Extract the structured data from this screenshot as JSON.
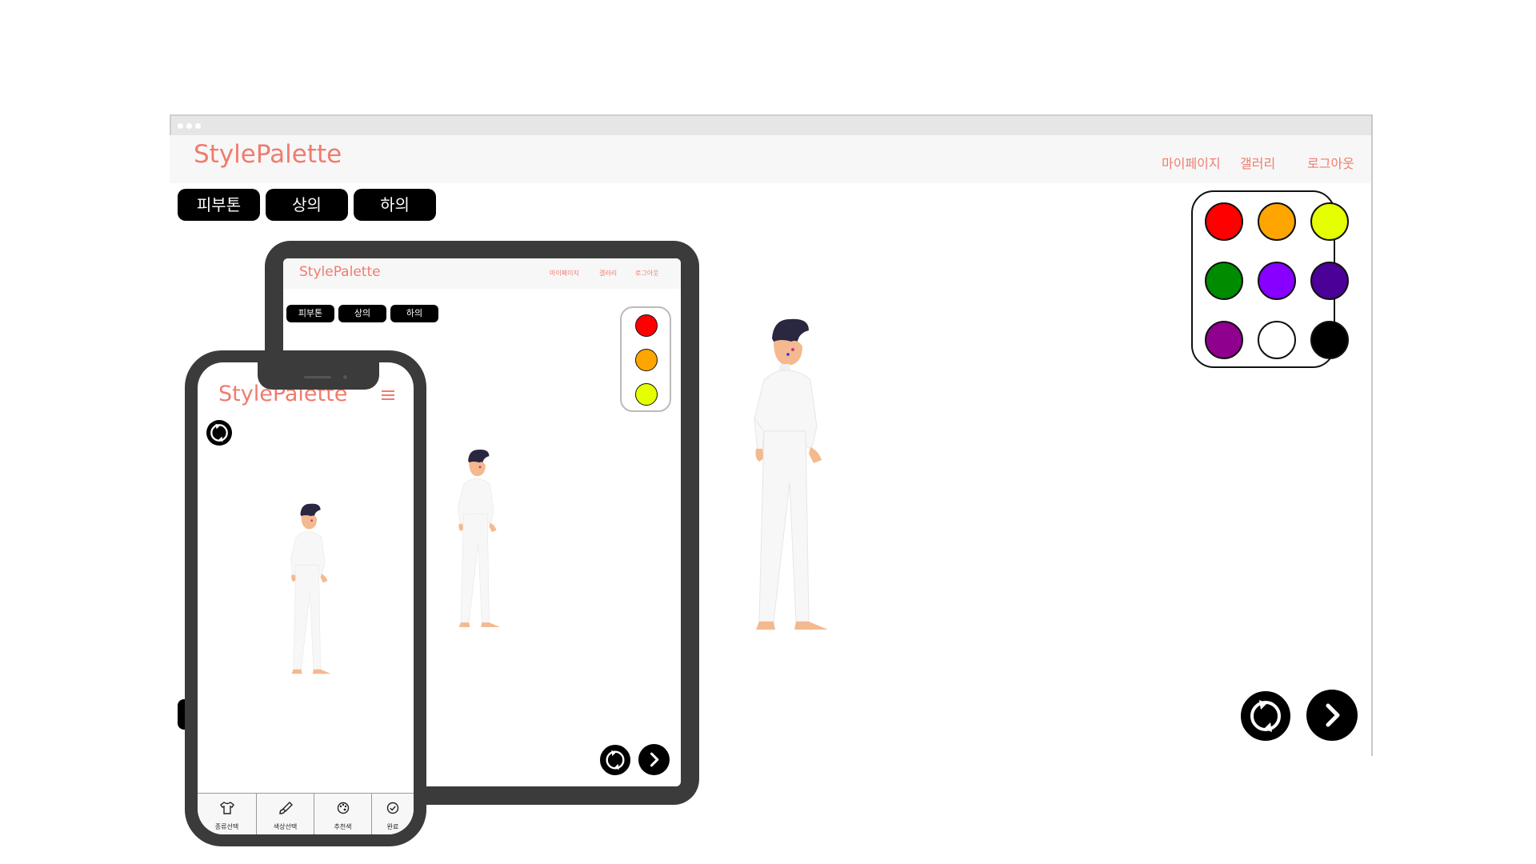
{
  "desktop": {
    "brand": "StylePalette",
    "nav": [
      "마이페이지",
      "갤러리",
      "로그아웃"
    ],
    "categories": [
      "피부톤",
      "상의",
      "하의"
    ],
    "palette": [
      "#ff0000",
      "#ffa500",
      "#e5ff00",
      "#008c00",
      "#8800ff",
      "#4b0097",
      "#8f008f",
      "#ffffff",
      "#000000"
    ]
  },
  "tablet": {
    "brand": "StylePalette",
    "nav": [
      "마이페이지",
      "갤러리",
      "로그아웃"
    ],
    "categories": [
      "피부톤",
      "상의",
      "하의"
    ],
    "palette": [
      "#ff0000",
      "#ffa500",
      "#e5ff00"
    ]
  },
  "mobile": {
    "brand": "StylePalette",
    "tabs": [
      "종류선택",
      "색상선택",
      "추천색",
      "완료"
    ]
  },
  "colors": {
    "accent": "#f07b6e",
    "device": "#3b3b3b",
    "button": "#000000"
  }
}
